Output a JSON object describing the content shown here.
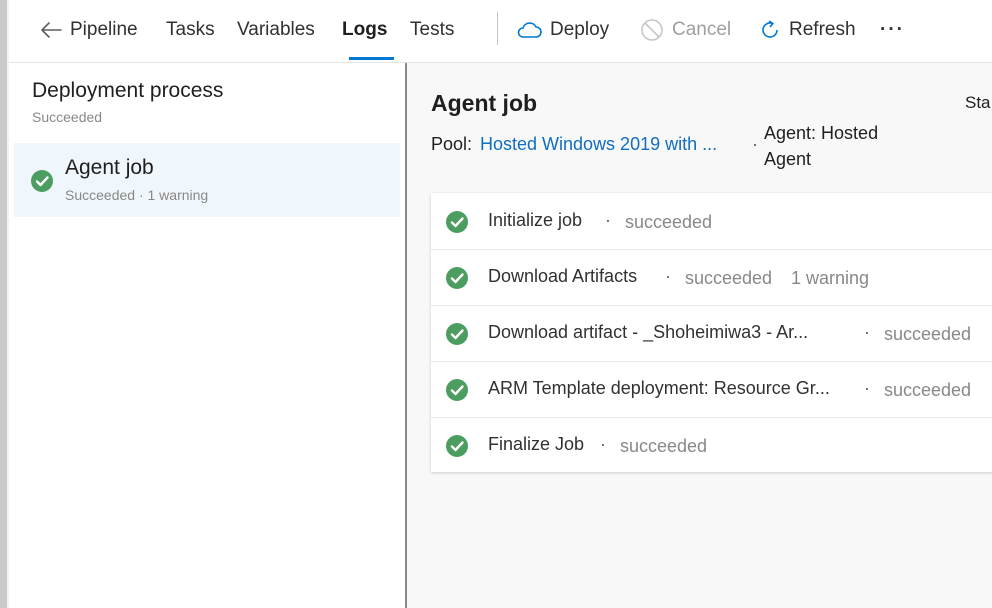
{
  "toolbar": {
    "pipeline_label": "Pipeline",
    "tasks_label": "Tasks",
    "variables_label": "Variables",
    "logs_label": "Logs",
    "tests_label": "Tests",
    "deploy_label": "Deploy",
    "cancel_label": "Cancel",
    "refresh_label": "Refresh",
    "more_label": "···"
  },
  "left_panel": {
    "title": "Deployment process",
    "status": "Succeeded",
    "job": {
      "title": "Agent job",
      "subtitle": "Succeeded · 1 warning"
    }
  },
  "right_panel": {
    "title": "Agent job",
    "truncated_header": "Sta",
    "pool_label": "Pool:",
    "pool_value": "Hosted Windows 2019 with ...",
    "separator": "·",
    "agent_label": "Agent: Hosted Agent",
    "steps": [
      {
        "name": "Initialize job",
        "status": "succeeded",
        "warning": ""
      },
      {
        "name": "Download Artifacts",
        "status": "succeeded",
        "warning": "1 warning"
      },
      {
        "name": "Download artifact - _Shoheimiwa3 - Ar...",
        "status": "succeeded",
        "warning": ""
      },
      {
        "name": "ARM Template deployment: Resource Gr...",
        "status": "succeeded",
        "warning": ""
      },
      {
        "name": "Finalize Job",
        "status": "succeeded",
        "warning": ""
      }
    ]
  },
  "colors": {
    "accent": "#0078d4",
    "link": "#106ebe",
    "success": "#4b9e5f",
    "selected_row_bg": "#eff6fc"
  },
  "icons": {
    "back": "arrow-left-icon",
    "deploy": "cloud-icon",
    "cancel": "cancel-circle-icon",
    "refresh": "refresh-icon",
    "success": "check-circle-icon"
  }
}
